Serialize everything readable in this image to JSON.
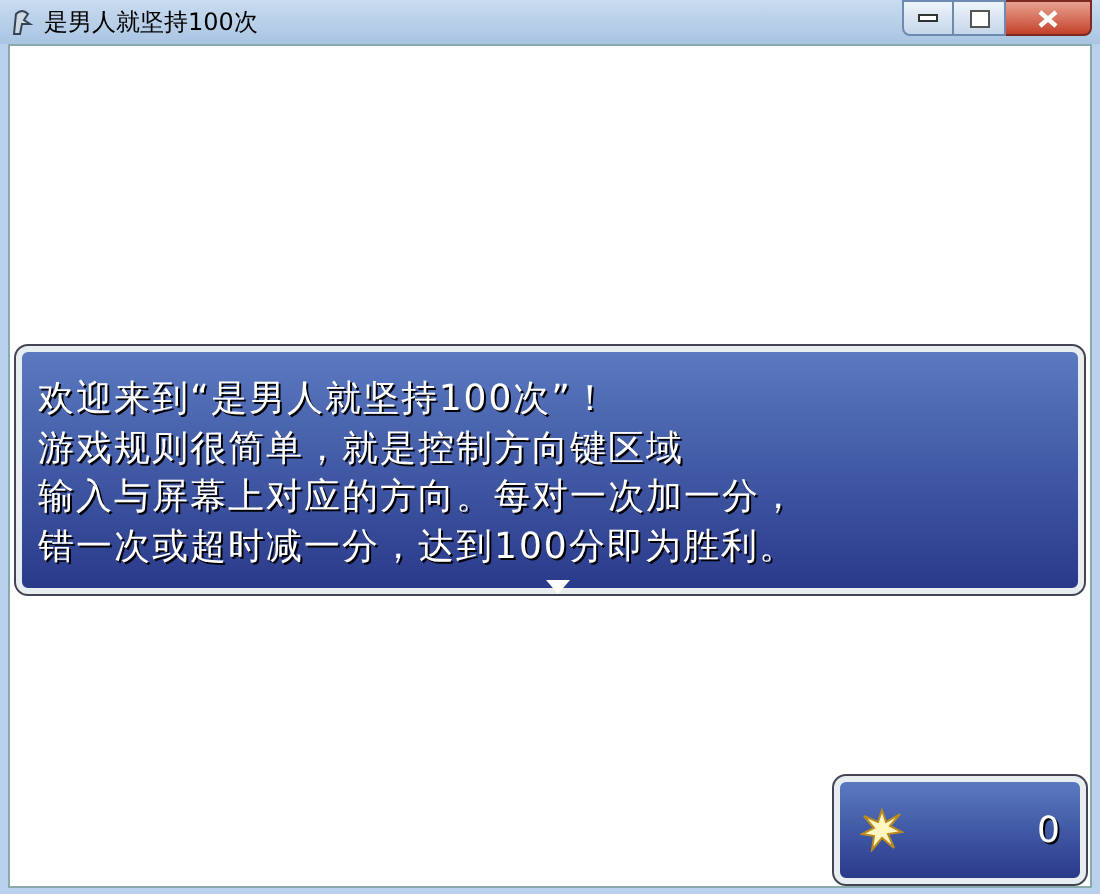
{
  "window": {
    "title": "是男人就坚持100次"
  },
  "message": {
    "lines": [
      "欢迎来到“是男人就坚持100次”！",
      "游戏规则很简单，就是控制方向键区域",
      "输入与屏幕上对应的方向。每对一次加一分，",
      "错一次或超时减一分，达到100分即为胜利。"
    ]
  },
  "score": {
    "value": "0"
  }
}
